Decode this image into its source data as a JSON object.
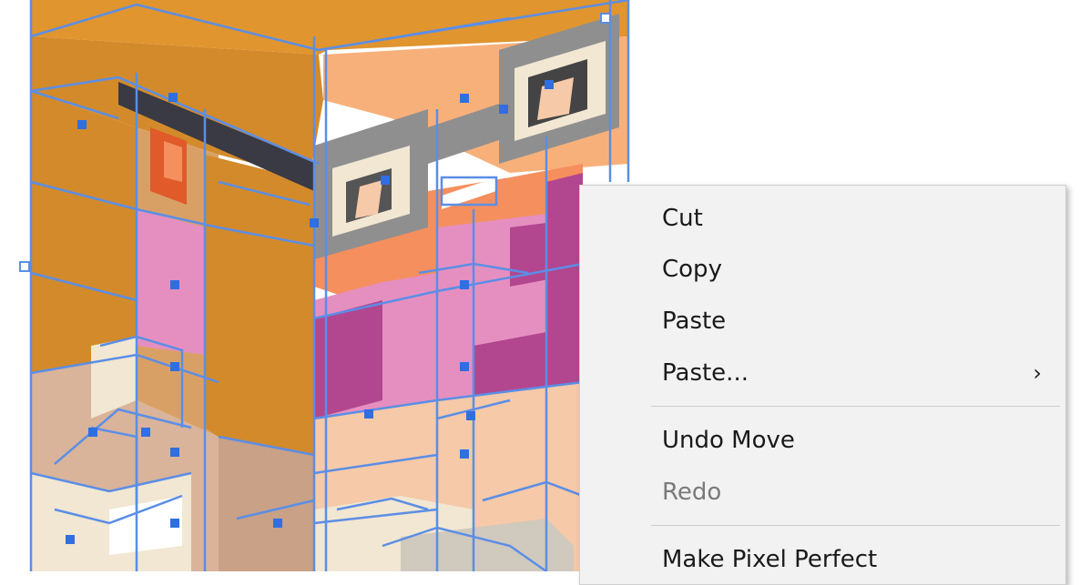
{
  "context_menu": {
    "items": [
      {
        "label": "Cut"
      },
      {
        "label": "Copy"
      },
      {
        "label": "Paste"
      },
      {
        "label": "Paste..."
      },
      {
        "label": "Undo Move"
      },
      {
        "label": "Redo"
      },
      {
        "label": "Make Pixel Perfect"
      }
    ],
    "submenu_icon": "chevron-right-icon",
    "submenu_glyph": "›"
  },
  "artwork": {
    "description": "selected isometric pixel character artwork",
    "colors": {
      "orange": "#e0952f",
      "dark_orange": "#d38a2b",
      "peach": "#f8b07a",
      "salmon": "#f58f5e",
      "pink": "#e58fc0",
      "magenta": "#b2478f",
      "skin": "#f6c9a8",
      "tan": "#d9b39a",
      "cream": "#f1e7d2",
      "gray": "#8f8f8f",
      "dark": "#444444",
      "selection": "#5b8ee6",
      "handle": "#2f6fe0"
    }
  }
}
